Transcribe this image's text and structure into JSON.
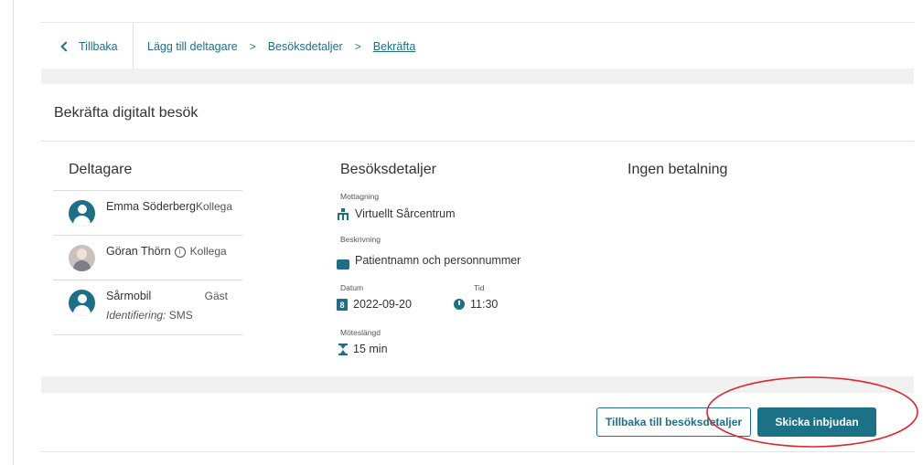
{
  "breadcrumb": {
    "back_label": "Tillbaka",
    "steps": [
      "Lägg till deltagare",
      "Besöksdetaljer",
      "Bekräfta"
    ],
    "separator": ">"
  },
  "page": {
    "title": "Bekräfta digitalt besök"
  },
  "participants": {
    "heading": "Deltagare",
    "items": [
      {
        "name": "Emma Söderberg",
        "role": "Kollega",
        "avatar": "person-icon"
      },
      {
        "name": "Göran Thörn",
        "role": "Kollega",
        "avatar": "photo",
        "info_icon": "i"
      },
      {
        "name": "Sårmobil",
        "role": "Gäst",
        "avatar": "person-icon",
        "ident_label": "Identifiering:",
        "ident_value": "SMS"
      }
    ]
  },
  "details": {
    "heading": "Besöksdetaljer",
    "reception": {
      "label": "Mottagning",
      "value": "Virtuellt Sårcentrum",
      "icon": "org-chart-icon"
    },
    "description": {
      "label": "Beskrivning",
      "value": "Patientnamn och personnummer",
      "icon": "chat-icon"
    },
    "date": {
      "label": "Datum",
      "value": "2022-09-20",
      "icon": "calendar-icon",
      "icon_text": "8"
    },
    "time": {
      "label": "Tid",
      "value": "11:30",
      "icon": "clock-icon"
    },
    "duration": {
      "label": "Möteslängd",
      "value": "15 min",
      "icon": "hourglass-icon"
    }
  },
  "payment": {
    "heading": "Ingen betalning"
  },
  "footer": {
    "back_button": "Tillbaka till besöksdetaljer",
    "send_button": "Skicka inbjudan"
  },
  "colors": {
    "accent": "#1b7186",
    "annotation": "#e0252b",
    "band": "#f1f1f1"
  }
}
